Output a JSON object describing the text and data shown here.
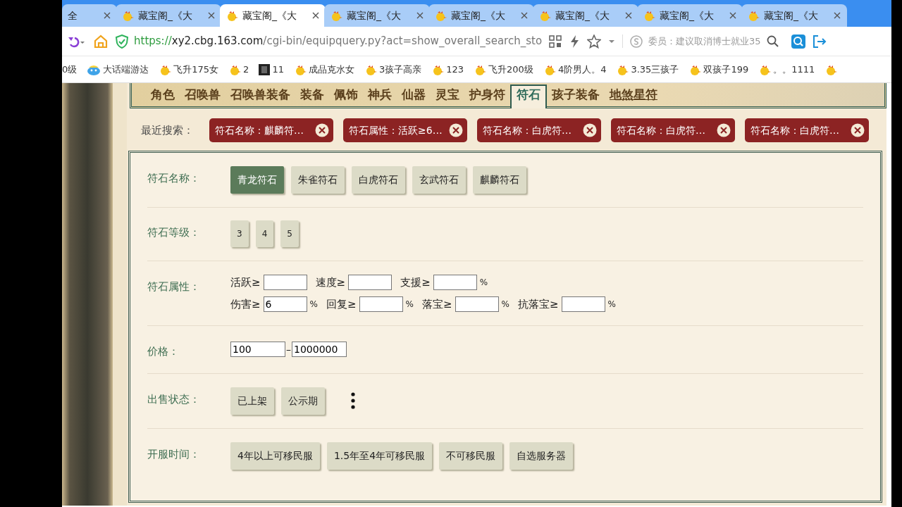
{
  "browser_tabs": [
    {
      "title": "全",
      "selected": false,
      "icon": false
    },
    {
      "title": "藏宝阁_《大",
      "selected": false,
      "icon": true
    },
    {
      "title": "藏宝阁_《大",
      "selected": true,
      "icon": true
    },
    {
      "title": "藏宝阁_《大",
      "selected": false,
      "icon": true
    },
    {
      "title": "藏宝阁_《大",
      "selected": false,
      "icon": true
    },
    {
      "title": "藏宝阁_《大",
      "selected": false,
      "icon": true
    },
    {
      "title": "藏宝阁_《大",
      "selected": false,
      "icon": true
    },
    {
      "title": "藏宝阁_《大",
      "selected": false,
      "icon": true
    }
  ],
  "address_bar": {
    "scheme": "https://",
    "host": "xy2.cbg.163.com",
    "path": "/cgi-bin/equipquery.py?act=show_overall_search_sto"
  },
  "search_box": {
    "text": "委员：建议取消博士就业35"
  },
  "bookmarks": [
    {
      "label": "0级",
      "kind": "none"
    },
    {
      "label": "大话端游达",
      "kind": "cloud"
    },
    {
      "label": "飞升175女",
      "kind": "chick"
    },
    {
      "label": "2",
      "kind": "chick"
    },
    {
      "label": "11",
      "kind": "dark"
    },
    {
      "label": "成品克水女",
      "kind": "chick"
    },
    {
      "label": "3孩子高亲",
      "kind": "chick"
    },
    {
      "label": "123",
      "kind": "chick"
    },
    {
      "label": "飞升200级",
      "kind": "chick"
    },
    {
      "label": "4阶男人。4",
      "kind": "chick"
    },
    {
      "label": "3.35三孩子",
      "kind": "chick"
    },
    {
      "label": "双孩子199",
      "kind": "chick"
    },
    {
      "label": "。。1111",
      "kind": "chick"
    }
  ],
  "category_tabs": [
    {
      "label": "角色",
      "selected": false,
      "hovered": false
    },
    {
      "label": "召唤兽",
      "selected": false,
      "hovered": false
    },
    {
      "label": "召唤兽装备",
      "selected": false,
      "hovered": false
    },
    {
      "label": "装备",
      "selected": false,
      "hovered": false
    },
    {
      "label": "佩饰",
      "selected": false,
      "hovered": false
    },
    {
      "label": "神兵",
      "selected": false,
      "hovered": false
    },
    {
      "label": "仙器",
      "selected": false,
      "hovered": false
    },
    {
      "label": "灵宝",
      "selected": false,
      "hovered": false
    },
    {
      "label": "护身符",
      "selected": false,
      "hovered": false
    },
    {
      "label": "符石",
      "selected": true,
      "hovered": false
    },
    {
      "label": "孩子装备",
      "selected": false,
      "hovered": false
    },
    {
      "label": "地煞星符",
      "selected": false,
      "hovered": true
    }
  ],
  "recent_searches": {
    "label": "最近搜索：",
    "items": [
      "符石名称：麒麟符…",
      "符石属性：活跃≥6…",
      "符石名称：白虎符…",
      "符石名称：白虎符…",
      "符石名称：白虎符…"
    ]
  },
  "filters": [
    {
      "label": "符石名称：",
      "kind": "options",
      "options": [
        {
          "label": "青龙符石",
          "selected": true
        },
        {
          "label": "朱雀符石",
          "selected": false
        },
        {
          "label": "白虎符石",
          "selected": false
        },
        {
          "label": "玄武符石",
          "selected": false
        },
        {
          "label": "麒麟符石",
          "selected": false
        }
      ]
    },
    {
      "label": "符石等级：",
      "kind": "options",
      "options": [
        {
          "label": "3",
          "selected": false
        },
        {
          "label": "4",
          "selected": false
        },
        {
          "label": "5",
          "selected": false
        }
      ]
    },
    {
      "label": "符石属性：",
      "kind": "attributes",
      "lines": [
        [
          {
            "label": "活跃≥"
          },
          {
            "label": "速度≥"
          },
          {
            "label": "支援≥",
            "unit": "%"
          }
        ],
        [
          {
            "label": "伤害≥",
            "value": "6",
            "unit": "%"
          },
          {
            "label": "回复≥",
            "unit": "%"
          },
          {
            "label": "落宝≥",
            "unit": "%"
          },
          {
            "label": "抗落宝≥",
            "unit": "%"
          }
        ]
      ]
    },
    {
      "label": "价格：",
      "kind": "range",
      "min": "100",
      "separator": "–",
      "max": "1000000"
    },
    {
      "label": "出售状态：",
      "kind": "options",
      "more": true,
      "options": [
        {
          "label": "已上架",
          "selected": false
        },
        {
          "label": "公示期",
          "selected": false
        }
      ]
    },
    {
      "label": "开服时间：",
      "kind": "options",
      "options": [
        {
          "label": "4年以上可移民服",
          "selected": false
        },
        {
          "label": "1.5年至4年可移民服",
          "selected": false
        },
        {
          "label": "不可移民服",
          "selected": false
        },
        {
          "label": "自选服务器",
          "selected": false
        }
      ]
    }
  ]
}
